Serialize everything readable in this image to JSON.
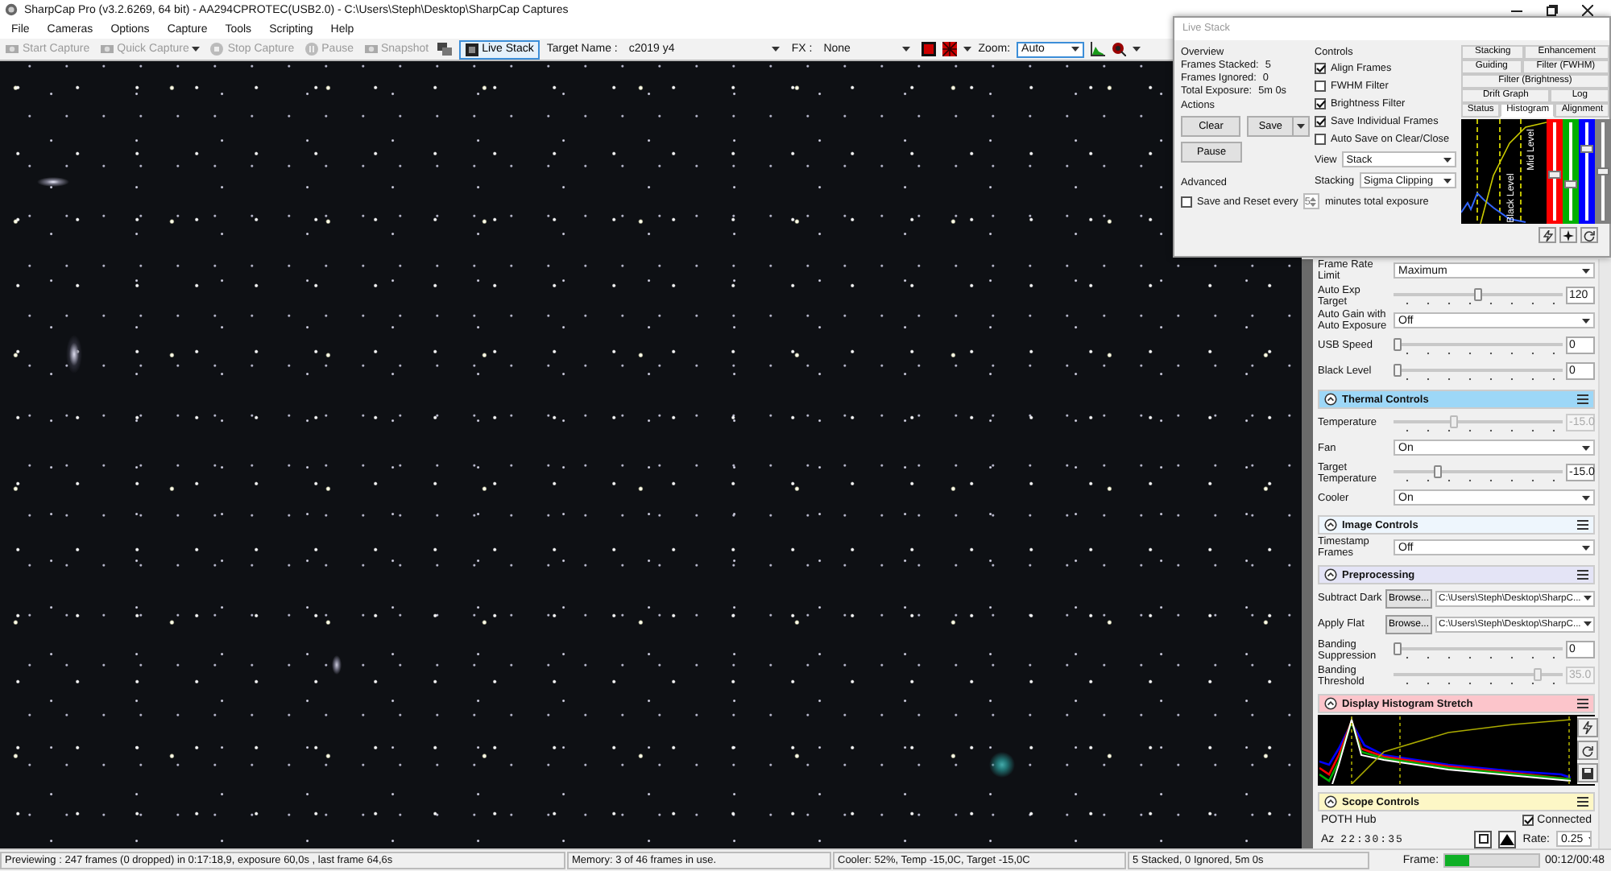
{
  "window": {
    "title": "SharpCap Pro (v3.2.6269, 64 bit) - AA294CPROTEC(USB2.0) - C:\\Users\\Steph\\Desktop\\SharpCap Captures"
  },
  "menu": [
    "File",
    "Cameras",
    "Options",
    "Capture",
    "Tools",
    "Scripting",
    "Help"
  ],
  "toolbar": {
    "buttons": [
      {
        "label": "Start Capture",
        "disabled": true,
        "dropdown": false
      },
      {
        "label": "Quick Capture",
        "disabled": true,
        "dropdown": true
      },
      {
        "label": "Stop Capture",
        "disabled": true,
        "dropdown": false
      },
      {
        "label": "Pause",
        "disabled": true,
        "dropdown": false
      },
      {
        "label": "Snapshot",
        "disabled": true,
        "dropdown": false
      }
    ],
    "live_stack": {
      "label": "Live Stack",
      "selected": true
    },
    "target": {
      "label": "Target Name :",
      "value": "c2019 y4"
    },
    "fx": {
      "label": "FX :",
      "value": "None"
    },
    "zoom": {
      "label": "Zoom:",
      "value": "Auto"
    }
  },
  "live_stack": {
    "title": "Live Stack",
    "overview": {
      "heading": "Overview",
      "stats": [
        {
          "label": "Frames Stacked:",
          "value": "5"
        },
        {
          "label": "Frames Ignored:",
          "value": "0"
        },
        {
          "label": "Total Exposure:",
          "value": "5m 0s"
        }
      ]
    },
    "actions": {
      "heading": "Actions",
      "clear": "Clear",
      "save": "Save",
      "pause": "Pause"
    },
    "advanced": {
      "heading": "Advanced",
      "reset": {
        "label": "Save and Reset every",
        "checked": false
      },
      "minutes": "5",
      "suffix": "minutes total exposure"
    },
    "controls": {
      "heading": "Controls",
      "options": [
        {
          "label": "Align Frames",
          "checked": true
        },
        {
          "label": "FWHM Filter",
          "checked": false
        },
        {
          "label": "Brightness Filter",
          "checked": true
        },
        {
          "label": "Save Individual Frames",
          "checked": true
        },
        {
          "label": "Auto Save on Clear/Close",
          "checked": false
        }
      ],
      "view": {
        "label": "View",
        "value": "Stack"
      },
      "stacking": {
        "label": "Stacking",
        "value": "Sigma Clipping"
      }
    },
    "tab_rows": [
      [
        {
          "label": "Stacking",
          "selected": false
        },
        {
          "label": "Enhancement",
          "selected": false
        }
      ],
      [
        {
          "label": "Guiding",
          "selected": false
        },
        {
          "label": "Filter (FWHM)",
          "selected": false
        }
      ],
      [
        {
          "label": "Filter (Brightness)",
          "selected": false
        }
      ],
      [
        {
          "label": "Drift Graph",
          "selected": false
        },
        {
          "label": "Log",
          "selected": false
        }
      ],
      [
        {
          "label": "Status",
          "selected": false
        },
        {
          "label": "Histogram",
          "selected": true
        },
        {
          "label": "Alignment",
          "selected": false
        }
      ]
    ],
    "histogram": {
      "labels": [
        "Mid Level",
        "Black Level"
      ],
      "channels": [
        {
          "color": "#ff0000",
          "level": 0.47
        },
        {
          "color": "#00b000",
          "level": 0.36
        },
        {
          "color": "#0000ff",
          "level": 0.73
        },
        {
          "color": "#808080",
          "level": 0.5
        }
      ]
    }
  },
  "panel": {
    "rows": [
      {
        "kind": "select",
        "label": "Frame Rate Limit",
        "value": "Maximum"
      },
      {
        "kind": "slider",
        "label": "Auto Exp Target",
        "level": 0.5,
        "value": "120",
        "disabled": false
      },
      {
        "kind": "select",
        "label": "Auto Gain with Auto Exposure",
        "value": "Off"
      },
      {
        "kind": "slider",
        "label": "USB Speed",
        "level": 0,
        "value": "0",
        "disabled": false
      },
      {
        "kind": "slider",
        "label": "Black Level",
        "level": 0,
        "value": "0",
        "disabled": false
      },
      {
        "kind": "header",
        "label": "Thermal Controls",
        "color": "#9dd7f7"
      },
      {
        "kind": "slider",
        "label": "Temperature",
        "level": 0.35,
        "value": "-15.0",
        "disabled": true
      },
      {
        "kind": "select",
        "label": "Fan",
        "value": "On"
      },
      {
        "kind": "slider",
        "label": "Target Temperature",
        "level": 0.25,
        "value": "-15.0",
        "disabled": false
      },
      {
        "kind": "select",
        "label": "Cooler",
        "value": "On"
      },
      {
        "kind": "header",
        "label": "Image Controls",
        "color": "#eef6fd"
      },
      {
        "kind": "select",
        "label": "Timestamp Frames",
        "value": "Off"
      },
      {
        "kind": "header",
        "label": "Preprocessing",
        "color": "#e4e4f6"
      },
      {
        "kind": "browse",
        "label": "Subtract Dark",
        "button": "Browse...",
        "value": "C:\\Users\\Steph\\Desktop\\SharpC..."
      },
      {
        "kind": "browse",
        "label": "Apply Flat",
        "button": "Browse...",
        "value": "C:\\Users\\Steph\\Desktop\\SharpC..."
      },
      {
        "kind": "slider",
        "label": "Banding Suppression",
        "level": 0,
        "value": "0",
        "disabled": false
      },
      {
        "kind": "slider",
        "label": "Banding Threshold",
        "level": 0.87,
        "value": "35.0",
        "disabled": true
      },
      {
        "kind": "header",
        "label": "Display Histogram Stretch",
        "color": "#fcc5cb"
      },
      {
        "kind": "histogram"
      },
      {
        "kind": "header",
        "label": "Scope Controls",
        "color": "#fdf7c6"
      },
      {
        "kind": "scope",
        "label": "POTH Hub",
        "connected": {
          "label": "Connected",
          "checked": true
        },
        "az_label": "Az",
        "az_value": "22:30:35",
        "rate_label": "Rate:",
        "rate_value": "0.25"
      }
    ]
  },
  "status_bar": {
    "segments": [
      "Previewing : 247 frames (0 dropped) in 0:17:18,9, exposure 60,0s , last frame 64,6s",
      "Memory: 3 of 46 frames in use.",
      "Cooler: 52%, Temp -15,0C, Target -15,0C",
      "5 Stacked, 0 Ignored, 5m 0s"
    ],
    "frame": {
      "label": "Frame:",
      "level": 0.25
    },
    "time": "00:12/00:48"
  }
}
